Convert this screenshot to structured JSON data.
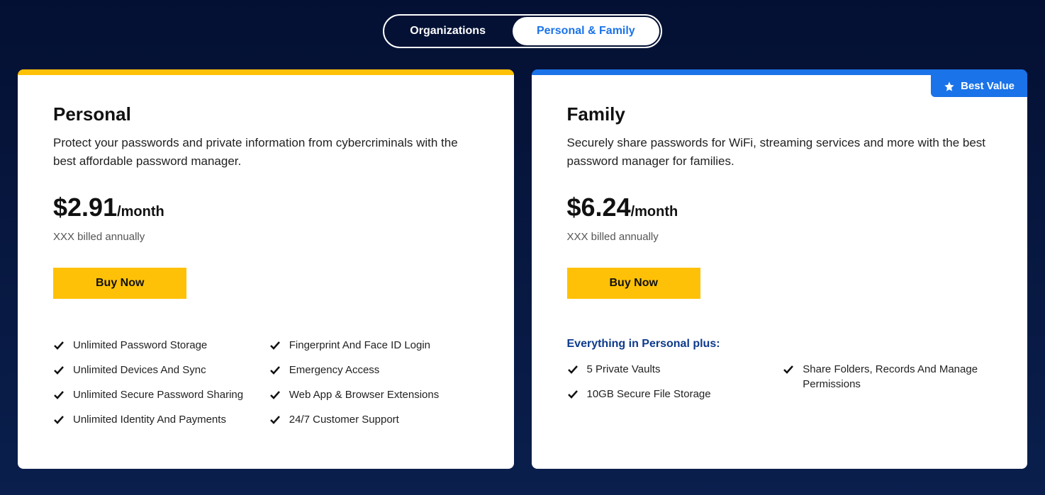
{
  "tabs": {
    "organizations": "Organizations",
    "personal_family": "Personal & Family"
  },
  "plans": {
    "personal": {
      "title": "Personal",
      "description": "Protect your passwords and private information from cybercriminals with the best affordable password manager.",
      "price": "$2.91",
      "per": "/month",
      "billing": "XXX billed annually",
      "cta": "Buy Now",
      "features_col1": [
        "Unlimited Password Storage",
        "Unlimited Devices And Sync",
        "Unlimited Secure Password Sharing",
        "Unlimited Identity And Payments"
      ],
      "features_col2": [
        "Fingerprint And Face ID Login",
        "Emergency Access",
        "Web App & Browser Extensions",
        "24/7 Customer Support"
      ]
    },
    "family": {
      "badge": "Best Value",
      "title": "Family",
      "description": "Securely share passwords for WiFi, streaming services and more with the best password manager for families.",
      "price": "$6.24",
      "per": "/month",
      "billing": "XXX billed annually",
      "cta": "Buy Now",
      "plus_label": "Everything in Personal plus:",
      "features_col1": [
        "5 Private Vaults",
        "10GB Secure File Storage"
      ],
      "features_col2": [
        "Share Folders, Records And Manage Permissions"
      ]
    }
  }
}
